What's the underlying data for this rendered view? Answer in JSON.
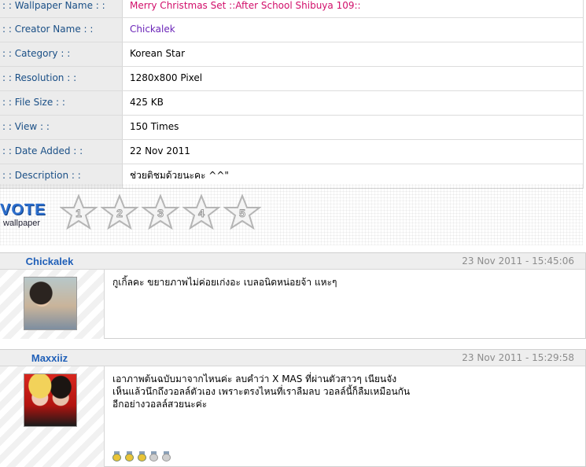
{
  "info": {
    "rows": [
      {
        "label": ": : Wallpaper Name : :",
        "value": "Merry Christmas Set ::After School Shibuya 109::"
      },
      {
        "label": ": : Creator Name : :",
        "value": "Chickalek"
      },
      {
        "label": ": : Category : :",
        "value": "Korean Star"
      },
      {
        "label": ": : Resolution : :",
        "value": "1280x800 Pixel"
      },
      {
        "label": ": : File Size : :",
        "value": "425 KB"
      },
      {
        "label": ": : View : :",
        "value": "150 Times"
      },
      {
        "label": ": : Date Added : :",
        "value": "22 Nov 2011"
      },
      {
        "label": ": : Description : :",
        "value": "ช่วยติชมด้วยนะคะ ^^\""
      }
    ]
  },
  "colors": {
    "label_text": "#1a4f86",
    "name_link": "#d10f6a",
    "creator_link": "#6a24b8",
    "comment_name": "#1f5fb8"
  },
  "vote": {
    "logo_text": "VOTE",
    "logo_subtext": "wallpaper",
    "stars": [
      "1",
      "2",
      "3",
      "4",
      "5"
    ]
  },
  "comments": [
    {
      "name": "Chickalek",
      "date": "23 Nov 2011 - 15:45:06",
      "lines": [
        "กูเกิ้ลคะ ขยายภาพไม่ค่อยเก่งอะ เบลอนิดหน่อยจ้า แหะๆ"
      ],
      "badges": []
    },
    {
      "name": "Maxxiiz",
      "date": "23 Nov 2011 - 15:29:58",
      "lines": [
        "เอาภาพต้นฉบับมาจากไหนค่ะ ลบคำว่า X MAS ที่ผ่านตัวสาวๆ เนียนจัง",
        "เห็นแล้วนึกถึงวอลล์ตัวเอง เพราะตรงไหนที่เราลืมลบ วอลล์นี้ก็ลืมเหมือนกัน",
        "อีกอย่างวอลล์สวยนะค่ะ"
      ],
      "badges": [
        "on",
        "on",
        "on",
        "off",
        "off"
      ]
    }
  ]
}
